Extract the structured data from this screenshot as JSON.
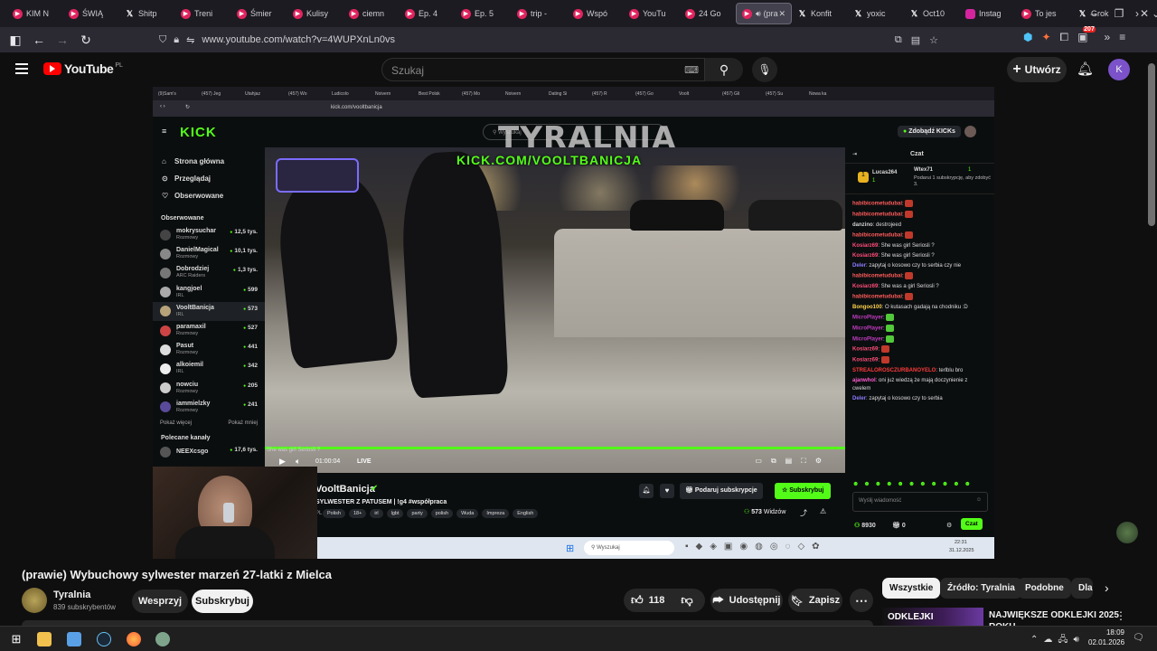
{
  "browser": {
    "tabs": [
      {
        "label": "KIM N",
        "kind": "yt"
      },
      {
        "label": "ŚWIĄ",
        "kind": "yt"
      },
      {
        "label": "Shitp",
        "kind": "x"
      },
      {
        "label": "Treni",
        "kind": "yt"
      },
      {
        "label": "Śmier",
        "kind": "yt"
      },
      {
        "label": "Kulisy",
        "kind": "yt"
      },
      {
        "label": "ciemn",
        "kind": "yt"
      },
      {
        "label": "Ep. 4",
        "kind": "yt"
      },
      {
        "label": "Ep. 5",
        "kind": "yt"
      },
      {
        "label": "trip -",
        "kind": "yt"
      },
      {
        "label": "Wspó",
        "kind": "yt"
      },
      {
        "label": "YouTu",
        "kind": "yt"
      },
      {
        "label": "24 Go",
        "kind": "yt"
      },
      {
        "label": "(pra",
        "kind": "yt",
        "active": true
      },
      {
        "label": "Konfit",
        "kind": "x"
      },
      {
        "label": "yoxic",
        "kind": "x"
      },
      {
        "label": "Oct10",
        "kind": "x"
      },
      {
        "label": "Instag",
        "kind": "ig"
      },
      {
        "label": "To jes",
        "kind": "yt"
      },
      {
        "label": "Grok",
        "kind": "x"
      }
    ],
    "url": "www.youtube.com/watch?v=4WUPXnLn0vs",
    "badge_count": "207"
  },
  "youtube": {
    "logo": "YouTube",
    "region": "PL",
    "search_placeholder": "Szukaj",
    "create_label": "Utwórz",
    "avatar_letter": "K",
    "video_title": "(prawie) Wybuchowy sylwester marzeń 27-latki z Mielca",
    "channel_name": "Tyralnia",
    "subscribers": "839 subskrybentów",
    "support_label": "Wesprzyj",
    "subscribe_label": "Subskrybuj",
    "likes": "118",
    "share_label": "Udostępnij",
    "save_label": "Zapisz",
    "chips": [
      "Wszystkie",
      "Źródło: Tyralnia",
      "Podobne",
      "Dla"
    ],
    "next_video_title": "NAJWIĘKSZE ODKLEJKI 2025",
    "next_video_sub": "ROKU",
    "next_thumb_text": "ODKLEJKI"
  },
  "stream": {
    "overlay_brand": "TYRALNIA",
    "inner_tabs": [
      "(9)Sam's",
      "(457) Jeg",
      "Utahjaz",
      "(457) Wo",
      "Ludicolo",
      "Noivern",
      "Best Polsk",
      "(457) Mo",
      "Noivern",
      "Dating Si",
      "(457) R",
      "(457) Go",
      "Voolt",
      "(457) Gli",
      "(457) Su",
      "Nowa ka"
    ],
    "inner_url": "kick.com/vooltbanicja",
    "kick_logo": "KICK",
    "kick_search": "Wyszukaj",
    "get_kicks": "Zdobądź KICKs",
    "nav": [
      {
        "label": "Strona główna",
        "icon": "home-icon"
      },
      {
        "label": "Przeglądaj",
        "icon": "browse-icon"
      },
      {
        "label": "Obserwowane",
        "icon": "heart-icon"
      }
    ],
    "followed_header": "Obserwowane",
    "channels": [
      {
        "name": "mokrysuchar",
        "cat": "Rozmowy",
        "viewers": "12,5 tys."
      },
      {
        "name": "DanielMagical",
        "cat": "Rozmowy",
        "viewers": "10,1 tys."
      },
      {
        "name": "Dobrodziej",
        "cat": "ARC Raiders",
        "viewers": "1,3 tys."
      },
      {
        "name": "kangjoel",
        "cat": "IRL",
        "viewers": "599"
      },
      {
        "name": "VooltBanicja",
        "cat": "IRL",
        "viewers": "573"
      },
      {
        "name": "paramaxil",
        "cat": "Rozmowy",
        "viewers": "527"
      },
      {
        "name": "Pasut",
        "cat": "Rozmowy",
        "viewers": "441"
      },
      {
        "name": "alkoiemil",
        "cat": "IRL",
        "viewers": "342"
      },
      {
        "name": "nowciu",
        "cat": "Rozmowy",
        "viewers": "205"
      },
      {
        "name": "iammielzky",
        "cat": "Rozmowy",
        "viewers": "241"
      }
    ],
    "show_more": "Pokaż więcej",
    "show_less": "Pokaż mniej",
    "recommended_header": "Polecane kanały",
    "recommended_first": {
      "name": "NEEXcsgo",
      "viewers": "17,6 tys."
    },
    "kick_url_overlay": "KICK.COM/VOOLTBANICJA",
    "time": "01:00:04",
    "live": "LIVE",
    "caption_snippet": "She was girl Seriosli ?",
    "streamer": "VooltBanicja",
    "stream_title": "SYLWESTER Z PATUSEM | !g4 #współpraca",
    "lang_short": "PL",
    "tags": [
      "Polish",
      "18+",
      "irl",
      "lgbt",
      "party",
      "polish",
      "Wuda",
      "Impreza",
      "English"
    ],
    "gift_sub": "Podaruj subskrypcje",
    "subscribe": "Subskrybuj",
    "viewers_count": "573",
    "viewers_label": "Widzów",
    "chat": {
      "header": "Czat",
      "gift_top": [
        {
          "name": "Lucas264",
          "count": "1"
        },
        {
          "name": "Wtex71",
          "count": "1"
        }
      ],
      "gift_text": "Podarui 1 subskrypcję, aby zdobyć 3.",
      "lines": [
        {
          "user": "habibicometudubai",
          "text": "",
          "color": "#ff5b5b"
        },
        {
          "user": "habibicometudubai",
          "text": "",
          "color": "#ff5b5b"
        },
        {
          "user": "danzino",
          "text": "destrojeed",
          "color": "#cfcfcf"
        },
        {
          "user": "habibicometudubai",
          "text": "",
          "color": "#ff5b5b"
        },
        {
          "user": "Kosiarz69",
          "text": "She was girl Seriosli ?",
          "color": "#ff4d7a"
        },
        {
          "user": "Kosiarz69",
          "text": "She was girl Seriosli ?",
          "color": "#ff4d7a"
        },
        {
          "user": "Deler",
          "text": "zapytaj o kosowo czy to serbia czy nie",
          "color": "#8a7cff"
        },
        {
          "user": "habibicometudubai",
          "text": "",
          "color": "#ff5b5b"
        },
        {
          "user": "Kosiarz69",
          "text": "She was a girl Seriosli ?",
          "color": "#ff4d7a"
        },
        {
          "user": "habibicometudubai",
          "text": "",
          "color": "#ff5b5b"
        },
        {
          "user": "Bongoo100",
          "text": "O kutasach gadają na chodniku :D",
          "color": "#ffd24d"
        },
        {
          "user": "MicroPlayer",
          "text": "",
          "color": "#c03cc0"
        },
        {
          "user": "MicroPlayer",
          "text": "",
          "color": "#c03cc0"
        },
        {
          "user": "MicroPlayer",
          "text": "",
          "color": "#c03cc0"
        },
        {
          "user": "Kosiarz69",
          "text": "",
          "color": "#ff4d7a"
        },
        {
          "user": "Kosiarz69",
          "text": "",
          "color": "#ff4d7a"
        },
        {
          "user": "STREALOROSCZURBANOYELO",
          "text": "terlblu bro",
          "color": "#ff3b3b"
        },
        {
          "user": "ajanwhol",
          "text": "oni już wiedzą że mają doczynienie z cwelem",
          "color": "#ff5bd1"
        },
        {
          "user": "Deler",
          "text": "zapytaj o kosowo czy to serbia",
          "color": "#8a7cff"
        }
      ],
      "input_placeholder": "Wyślij wiadomość",
      "points": "8930",
      "gifts": "0",
      "send_label": "Czat"
    },
    "clock_time": "22:31",
    "clock_date": "31.12.2025",
    "taskbar_search": "Wyszukaj"
  },
  "windows": {
    "time": "18:09",
    "date": "02.01.2026"
  },
  "colors": {
    "kick_green": "#53fc18",
    "yt_red": "#ff0000",
    "accent_purple": "#7b52c9"
  }
}
